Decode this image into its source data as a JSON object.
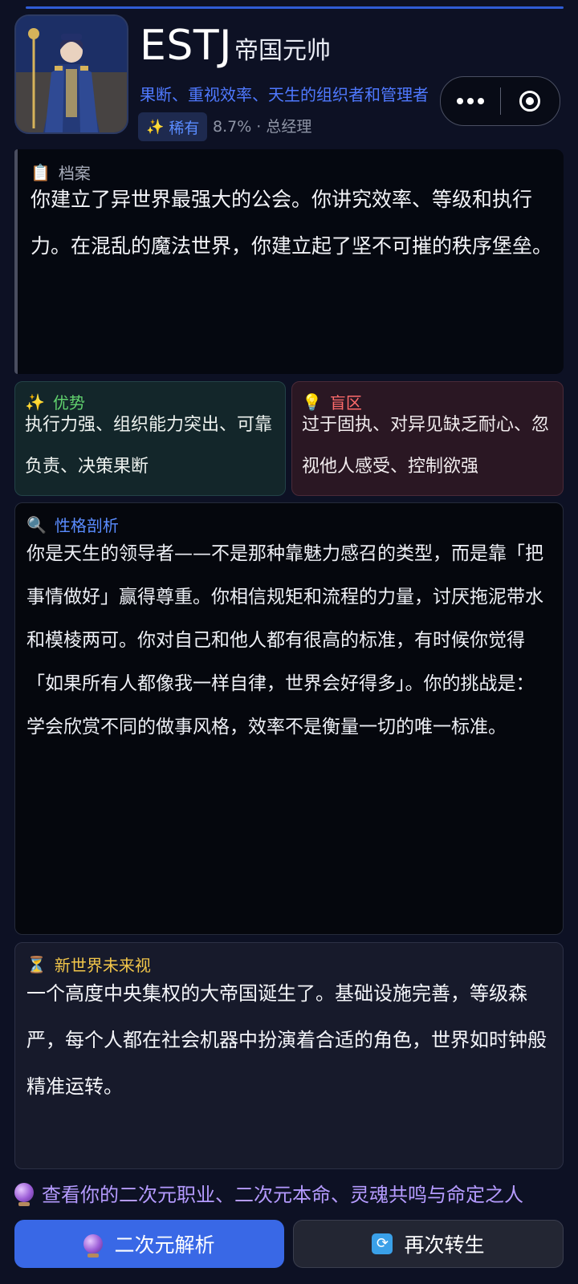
{
  "header": {
    "type_code": "ESTJ",
    "title": "帝国元帅",
    "tagline": "果断、重视效率、天生的组织者和管理者",
    "rarity_label": "稀有",
    "rarity_meta": "8.7% · 总经理"
  },
  "archive": {
    "heading": "档案",
    "body": "你建立了异世界最强大的公会。你讲究效率、等级和执行力。在混乱的魔法世界，你建立起了坚不可摧的秩序堡垒。"
  },
  "strengths": {
    "heading": "优势",
    "body": "执行力强、组织能力突出、可靠负责、决策果断"
  },
  "blindspots": {
    "heading": "盲区",
    "body": "过于固执、对异见缺乏耐心、忽视他人感受、控制欲强"
  },
  "analysis": {
    "heading": "性格剖析",
    "body": "你是天生的领导者——不是那种靠魅力感召的类型，而是靠「把事情做好」赢得尊重。你相信规矩和流程的力量，讨厌拖泥带水和模棱两可。你对自己和他人都有很高的标准，有时候你觉得「如果所有人都像我一样自律，世界会好得多」。你的挑战是：学会欣赏不同的做事风格，效率不是衡量一切的唯一标准。"
  },
  "future": {
    "heading": "新世界未来视",
    "body": "一个高度中央集权的大帝国诞生了。基础设施完善，等级森严，每个人都在社会机器中扮演着合适的角色，世界如时钟般精准运转。"
  },
  "promo_text": "查看你的二次元职业、二次元本命、灵魂共鸣与命定之人",
  "buttons": {
    "primary_label": "二次元解析",
    "secondary_label": "再次转生"
  },
  "icons": {
    "archive": "clipboard-icon",
    "strengths": "sparkles-icon",
    "blindspots": "lightbulb-icon",
    "analysis": "magnifier-icon",
    "future": "hourglass-icon",
    "promo": "crystal-ball-icon",
    "secondary": "refresh-icon"
  },
  "colors": {
    "accent": "#3968e6",
    "strength": "#61d26e",
    "blindspot": "#ff6b6b",
    "analysis": "#5a8cff",
    "future": "#f2c64a"
  }
}
